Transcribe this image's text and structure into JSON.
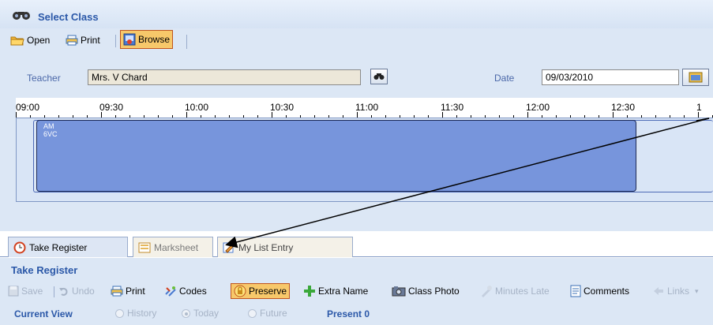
{
  "select_class": {
    "title": "Select Class",
    "toolbar": {
      "open": "Open",
      "print": "Print",
      "browse": "Browse"
    },
    "teacher_label": "Teacher",
    "teacher_value": "Mrs. V Chard",
    "date_label": "Date",
    "date_value": "09/03/2010",
    "timeline": {
      "times": [
        "09:00",
        "09:30",
        "10:00",
        "10:30",
        "11:00",
        "11:30",
        "12:00",
        "12:30",
        "1"
      ],
      "period": {
        "session": "AM",
        "class": "6VC"
      }
    }
  },
  "tabs": [
    {
      "label": "Take Register"
    },
    {
      "label": "Marksheet"
    },
    {
      "label": "My List Entry"
    }
  ],
  "take_register": {
    "title": "Take Register",
    "toolbar": {
      "save": "Save",
      "undo": "Undo",
      "print": "Print",
      "codes": "Codes",
      "preserve": "Preserve",
      "extra_name": "Extra Name",
      "class_photo": "Class Photo",
      "minutes_late": "Minutes Late",
      "comments": "Comments",
      "links": "Links"
    },
    "view": {
      "label": "Current View",
      "options": [
        "History",
        "Today",
        "Future"
      ],
      "selected": "Today",
      "present_label": "Present",
      "present_count": "0"
    }
  },
  "colors": {
    "accent": "#2b58a8",
    "active_button": "#f7c86a",
    "period_block": "#7795dc",
    "panel": "#dce7f5"
  }
}
